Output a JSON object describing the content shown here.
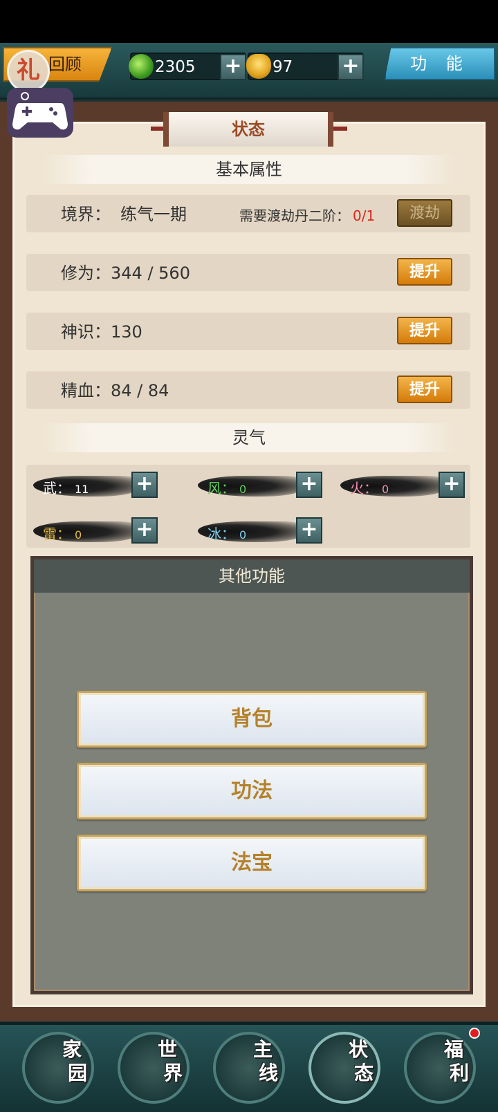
{
  "topbar": {
    "review_label": "回顾",
    "gift_icon_char": "礼",
    "jade": {
      "value": "2305",
      "icon": "jade-coin-icon"
    },
    "ingot": {
      "value": "97",
      "icon": "gold-ingot-icon"
    },
    "plus": "+",
    "function_label": "功 能"
  },
  "panel": {
    "title": "状态",
    "basic_header": "基本属性",
    "realm": {
      "label": "境界：",
      "value": "练气一期",
      "need_label": "需要渡劫丹二阶：",
      "need_value": "0/1",
      "button": "渡劫"
    },
    "cultivation": {
      "label": "修为：",
      "value": "344 / 560",
      "button": "提升"
    },
    "spirit": {
      "label": "神识：",
      "value": "130",
      "button": "提升"
    },
    "blood": {
      "label": "精血：",
      "value": "84 / 84",
      "button": "提升"
    },
    "qi_header": "灵气",
    "qi": [
      {
        "label": "武：",
        "value": "11",
        "color": "#ffffff"
      },
      {
        "label": "风：",
        "value": "0",
        "color": "#5fd35f"
      },
      {
        "label": "火：",
        "value": "0",
        "color": "#f58fb0"
      },
      {
        "label": "雷：",
        "value": "0",
        "color": "#e8b83c"
      },
      {
        "label": "冰：",
        "value": "0",
        "color": "#7fd0f0"
      }
    ]
  },
  "other": {
    "header": "其他功能",
    "buttons": [
      "背包",
      "功法",
      "法宝"
    ]
  },
  "nav": [
    {
      "t1": "家",
      "t2": "园"
    },
    {
      "t1": "世",
      "t2": "界"
    },
    {
      "t1": "主",
      "t2": "线"
    },
    {
      "t1": "状",
      "t2": "态"
    },
    {
      "t1": "福",
      "t2": "利"
    }
  ],
  "colors": {
    "accent_orange": "#d98610",
    "teal": "#2b5a5c",
    "red": "#d6281c"
  }
}
